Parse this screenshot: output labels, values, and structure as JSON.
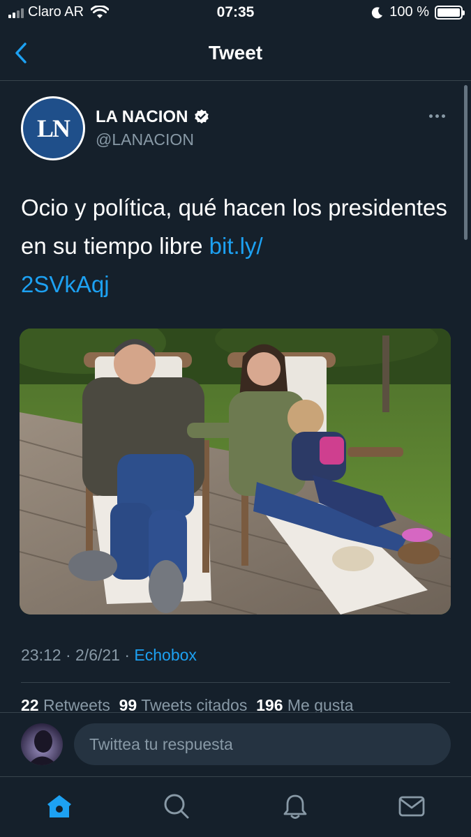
{
  "status": {
    "carrier": "Claro AR",
    "time": "07:35",
    "battery": "100 %",
    "battery_level": 1.0
  },
  "nav": {
    "title": "Tweet",
    "back_icon": "chevron-left-icon"
  },
  "author": {
    "avatar_text": "LN",
    "name": "LA NACION",
    "handle": "@LANACION",
    "verified_icon": "verified-badge-icon",
    "more_icon": "more-horizontal-icon"
  },
  "tweet": {
    "text": "Ocio y política, qué hacen los presidentes en su tiempo libre ",
    "link": "bit.ly/\n2SVkAqj"
  },
  "meta": {
    "time": "23:12",
    "sep1": " · ",
    "date": "2/6/21",
    "sep2": " · ",
    "source": "Echobox"
  },
  "counts": {
    "retweets_num": "22",
    "retweets_label": " Retweets  ",
    "quotes_num": "99",
    "quotes_label": " Tweets citados  ",
    "likes_num": "196",
    "likes_label": " Me gusta"
  },
  "reply": {
    "placeholder": "Twittea tu respuesta"
  },
  "tabs": [
    {
      "icon": "home-icon",
      "active": true
    },
    {
      "icon": "search-icon",
      "active": false
    },
    {
      "icon": "notifications-bell-icon",
      "active": false
    },
    {
      "icon": "messages-envelope-icon",
      "active": false
    }
  ],
  "colors": {
    "background": "#15202b",
    "accent": "#1da1f2",
    "secondary_text": "#8899a6",
    "divider": "#38444d"
  }
}
